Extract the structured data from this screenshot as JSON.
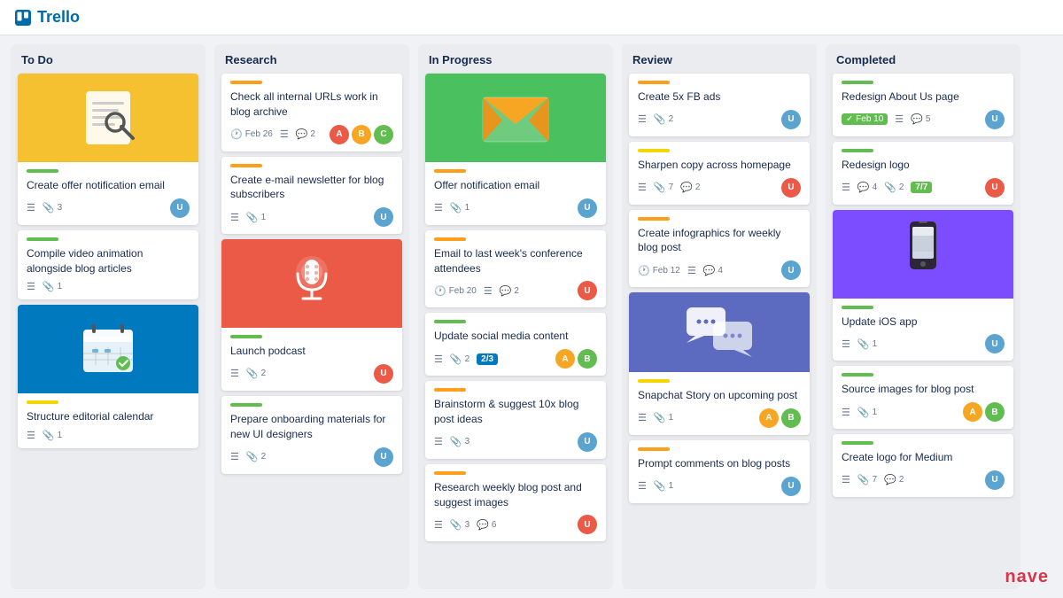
{
  "app": {
    "name": "Trello",
    "logo_text": "Trello"
  },
  "columns": [
    {
      "id": "todo",
      "title": "To Do",
      "label_color": "green",
      "cards": [
        {
          "id": "todo-1",
          "has_image": true,
          "image_type": "document",
          "label": "green",
          "title": "Create offer notification email",
          "meta": {
            "list": true,
            "attachments": 3
          },
          "avatars": [
            {
              "color": "#5ba4cf"
            }
          ]
        },
        {
          "id": "todo-2",
          "has_image": false,
          "label": "green",
          "title": "Compile video animation alongside blog articles",
          "meta": {
            "list": true,
            "attachments": 1
          },
          "avatars": []
        },
        {
          "id": "todo-3",
          "has_image": true,
          "image_type": "calendar",
          "label": "yellow",
          "title": "Structure editorial calendar",
          "meta": {
            "list": true,
            "attachments": 1
          },
          "avatars": []
        }
      ]
    },
    {
      "id": "research",
      "title": "Research",
      "label_color": "orange",
      "cards": [
        {
          "id": "research-1",
          "has_image": false,
          "label": "orange",
          "title": "Check all internal URLs work in blog archive",
          "date": "Feb 26",
          "meta": {
            "list": true,
            "comments": 2
          },
          "avatars": [
            {
              "color": "#eb5a46"
            },
            {
              "color": "#f6a623"
            },
            {
              "color": "#61bd4f"
            }
          ]
        },
        {
          "id": "research-2",
          "has_image": false,
          "label": "orange",
          "title": "Create e-mail newsletter for blog subscribers",
          "meta": {
            "list": true,
            "attachments": 1
          },
          "avatars": [
            {
              "color": "#5ba4cf"
            }
          ]
        },
        {
          "id": "research-3",
          "has_image": true,
          "image_type": "microphone",
          "label": "green",
          "title": "Launch podcast",
          "meta": {
            "list": true,
            "attachments": 2
          },
          "avatars": [
            {
              "color": "#eb5a46"
            }
          ]
        },
        {
          "id": "research-4",
          "has_image": false,
          "label": "green",
          "title": "Prepare onboarding materials for new UI designers",
          "meta": {
            "list": true,
            "attachments": 2
          },
          "avatars": [
            {
              "color": "#5ba4cf"
            }
          ]
        }
      ]
    },
    {
      "id": "inprogress",
      "title": "In Progress",
      "label_color": "orange",
      "cards": [
        {
          "id": "inprogress-1",
          "has_image": true,
          "image_type": "email",
          "label": "orange",
          "title": "Offer notification email",
          "meta": {
            "list": true,
            "attachments": 1
          },
          "avatars": [
            {
              "color": "#5ba4cf"
            }
          ]
        },
        {
          "id": "inprogress-2",
          "has_image": false,
          "label": "orange",
          "title": "Email to last week's conference attendees",
          "date": "Feb 20",
          "meta": {
            "list": true,
            "comments": 2
          },
          "avatars": [
            {
              "color": "#eb5a46"
            }
          ]
        },
        {
          "id": "inprogress-3",
          "has_image": false,
          "label": "green",
          "title": "Update social media content",
          "meta": {
            "list": true,
            "attachments": 2,
            "progress": "2/3"
          },
          "avatars": [
            {
              "color": "#f6a623"
            },
            {
              "color": "#61bd4f"
            }
          ]
        },
        {
          "id": "inprogress-4",
          "has_image": false,
          "label": "orange",
          "title": "Brainstorm & suggest 10x blog post ideas",
          "meta": {
            "list": true,
            "attachments": 3
          },
          "avatars": [
            {
              "color": "#5ba4cf"
            }
          ]
        },
        {
          "id": "inprogress-5",
          "has_image": false,
          "label": "orange",
          "title": "Research weekly blog post and suggest images",
          "meta": {
            "list": true,
            "attachments": 3,
            "comments": 6
          },
          "avatars": [
            {
              "color": "#eb5a46"
            }
          ]
        }
      ]
    },
    {
      "id": "review",
      "title": "Review",
      "label_color": "orange",
      "cards": [
        {
          "id": "review-1",
          "has_image": false,
          "label": "orange",
          "title": "Create 5x FB ads",
          "meta": {
            "list": true,
            "attachments": 2
          },
          "avatars": [
            {
              "color": "#5ba4cf"
            }
          ]
        },
        {
          "id": "review-2",
          "has_image": false,
          "label": "yellow",
          "title": "Sharpen copy across homepage",
          "meta": {
            "list": true,
            "attachments": 7,
            "comments": 2
          },
          "avatars": [
            {
              "color": "#eb5a46"
            }
          ]
        },
        {
          "id": "review-3",
          "has_image": false,
          "label": "orange",
          "title": "Create infographics for weekly blog post",
          "date": "Feb 12",
          "meta": {
            "list": true,
            "comments": 4
          },
          "avatars": [
            {
              "color": "#5ba4cf"
            }
          ]
        },
        {
          "id": "review-4",
          "has_image": true,
          "image_type": "chat",
          "label": "yellow",
          "title": "Snapchat Story on upcoming post",
          "meta": {
            "list": true,
            "attachments": 1
          },
          "avatars": [
            {
              "color": "#f6a623"
            },
            {
              "color": "#61bd4f"
            }
          ]
        },
        {
          "id": "review-5",
          "has_image": false,
          "label": "orange",
          "title": "Prompt comments on blog posts",
          "meta": {
            "list": true,
            "attachments": 1
          },
          "avatars": [
            {
              "color": "#5ba4cf"
            }
          ]
        }
      ]
    },
    {
      "id": "completed",
      "title": "Completed",
      "label_color": "green",
      "cards": [
        {
          "id": "completed-1",
          "has_image": false,
          "label": "green",
          "title": "Redesign About Us page",
          "date": "Feb 10",
          "meta": {
            "list": true,
            "comments": 5
          },
          "avatars": [
            {
              "color": "#5ba4cf"
            }
          ]
        },
        {
          "id": "completed-2",
          "has_image": false,
          "label": "green",
          "title": "Redesign logo",
          "meta": {
            "list": true,
            "comments": 4,
            "attachments": 2,
            "progress": "7/7"
          },
          "avatars": [
            {
              "color": "#eb5a46"
            }
          ]
        },
        {
          "id": "completed-3",
          "has_image": true,
          "image_type": "phone",
          "label": "green",
          "title": "Update iOS app",
          "meta": {
            "list": true,
            "attachments": 1
          },
          "avatars": [
            {
              "color": "#5ba4cf"
            }
          ]
        },
        {
          "id": "completed-4",
          "has_image": false,
          "label": "green",
          "title": "Source images for blog post",
          "meta": {
            "list": true,
            "attachments": 1
          },
          "avatars": [
            {
              "color": "#f6a623"
            },
            {
              "color": "#61bd4f"
            }
          ]
        },
        {
          "id": "completed-5",
          "has_image": false,
          "label": "green",
          "title": "Create logo for Medium",
          "meta": {
            "list": true,
            "attachments": 7,
            "comments": 2
          },
          "avatars": [
            {
              "color": "#5ba4cf"
            }
          ]
        }
      ]
    }
  ],
  "watermark": "nave"
}
